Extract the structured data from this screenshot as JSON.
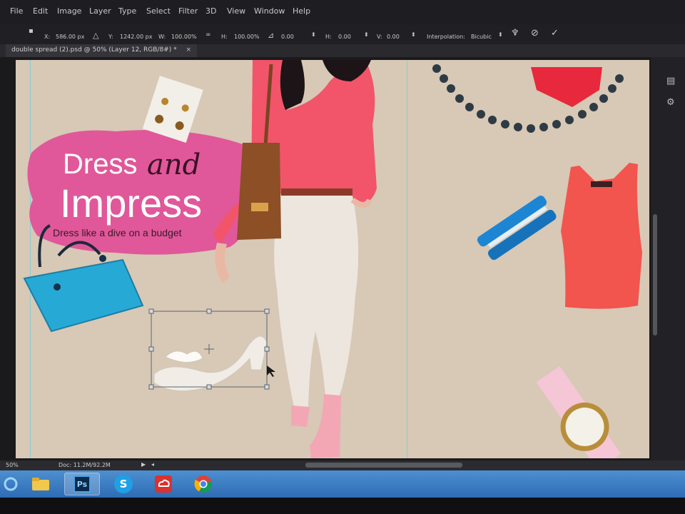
{
  "menu": [
    "File",
    "Edit",
    "Image",
    "Layer",
    "Type",
    "Select",
    "Filter",
    "3D",
    "View",
    "Window",
    "Help"
  ],
  "options": {
    "x_label": "X:",
    "x_value": "586.00 px",
    "y_label": "Y:",
    "y_value": "1242.00 px",
    "w_label": "W:",
    "w_value": "100.00%",
    "h_label": "H:",
    "h_value": "100.00%",
    "angle_value": "0.00",
    "hskew_label": "H:",
    "hskew_value": "0.00",
    "vskew_label": "V:",
    "vskew_value": "0.00",
    "interp_label": "Interpolation:",
    "interp_value": "Bicubic"
  },
  "document_tab": {
    "title": "double spread (2).psd @ 50% (Layer 12, RGB/8#) *",
    "close": "×"
  },
  "artwork": {
    "headline_1": "Dress",
    "headline_and": "and",
    "headline_2": "Impress",
    "tagline": "Dress like a dive on a budget",
    "splash_color": "#e0589a",
    "background_color": "#d8c8b6",
    "guide_color": "#72d2da"
  },
  "status": {
    "zoom": "50%",
    "doc": "Doc: 11.2M/92.2M"
  },
  "taskbar": {
    "apps": [
      {
        "icon": "file-explorer-icon"
      },
      {
        "icon": "photoshop-icon",
        "label": "Ps",
        "active": true
      },
      {
        "icon": "skype-icon",
        "label": "S"
      },
      {
        "icon": "creative-cloud-icon"
      },
      {
        "icon": "chrome-icon"
      }
    ]
  },
  "icons": [
    "chain-link-icon",
    "angle-icon",
    "warp-icon",
    "cancel-transform-icon",
    "commit-transform-icon"
  ]
}
